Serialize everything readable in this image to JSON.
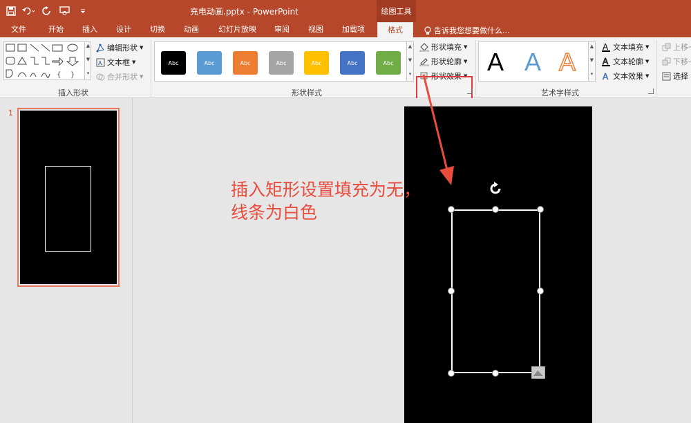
{
  "window": {
    "title": "充电动画.pptx - PowerPoint",
    "context_tab": "绘图工具"
  },
  "tabs": [
    {
      "label": "文件"
    },
    {
      "label": "开始"
    },
    {
      "label": "插入"
    },
    {
      "label": "设计"
    },
    {
      "label": "切换"
    },
    {
      "label": "动画"
    },
    {
      "label": "幻灯片放映"
    },
    {
      "label": "审阅"
    },
    {
      "label": "视图"
    },
    {
      "label": "加载项"
    },
    {
      "label": "格式"
    }
  ],
  "tell_me": "告诉我您想要做什么...",
  "groups": {
    "insert_shapes": {
      "label": "插入形状",
      "edit_shape": "编辑形状",
      "text_box": "文本框",
      "merge_shapes": "合并形状"
    },
    "shape_styles": {
      "label": "形状样式",
      "swatch_text": "Abc",
      "swatches": [
        "#000000",
        "#5b9bd5",
        "#ed7d31",
        "#a5a5a5",
        "#ffc000",
        "#4472c4",
        "#70ad47"
      ],
      "shape_fill": "形状填充",
      "shape_outline": "形状轮廓",
      "shape_effects": "形状效果"
    },
    "wordart": {
      "label": "艺术字样式",
      "sample_letter": "A",
      "text_fill": "文本填充",
      "text_outline": "文本轮廓",
      "text_effects": "文本效果"
    },
    "arrange": {
      "bring_forward": "上移一",
      "send_backward": "下移一",
      "selection_pane": "选择"
    }
  },
  "slides": [
    {
      "number": "1"
    }
  ],
  "annotation": {
    "line1": "插入矩形设置填充为无，",
    "line2": "线条为白色",
    "color": "#e84c3d"
  },
  "colors": {
    "accent": "#b7472a",
    "highlight": "#e03b3b"
  }
}
